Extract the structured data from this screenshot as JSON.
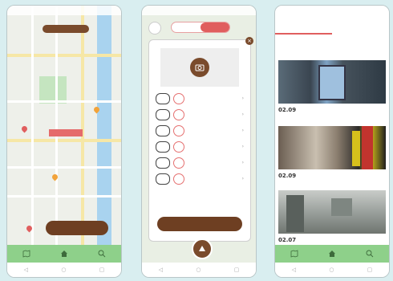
{
  "colors": {
    "background": "#d9eef0",
    "brand_brown": "#6e3f22",
    "tab_green": "#8ed08a",
    "accent_red": "#e05e5e"
  },
  "screens": {
    "map": {
      "status": "",
      "top_chip": "",
      "map_label": "",
      "list_button": "",
      "tabs": [
        {
          "label": "",
          "icon": "map-icon"
        },
        {
          "label": "",
          "icon": "home-icon"
        },
        {
          "label": "",
          "icon": "search-icon"
        }
      ]
    },
    "report": {
      "status": "",
      "segment": [
        "",
        ""
      ],
      "modal_title": "",
      "modal_note": "",
      "rows": [
        {
          "badge": "",
          "label": ""
        },
        {
          "badge": "",
          "label": ""
        },
        {
          "badge": "",
          "label": ""
        },
        {
          "badge": "",
          "label": ""
        },
        {
          "badge": "",
          "label": ""
        },
        {
          "badge": "",
          "label": ""
        }
      ],
      "submit_label": ""
    },
    "list": {
      "status": "",
      "tabs": [
        "",
        ""
      ],
      "filter_left": "",
      "filter_right": "",
      "cards": [
        {
          "date": "02.09",
          "info": ""
        },
        {
          "date": "02.09",
          "info": ""
        },
        {
          "date": "02.07",
          "info": ""
        }
      ]
    }
  }
}
